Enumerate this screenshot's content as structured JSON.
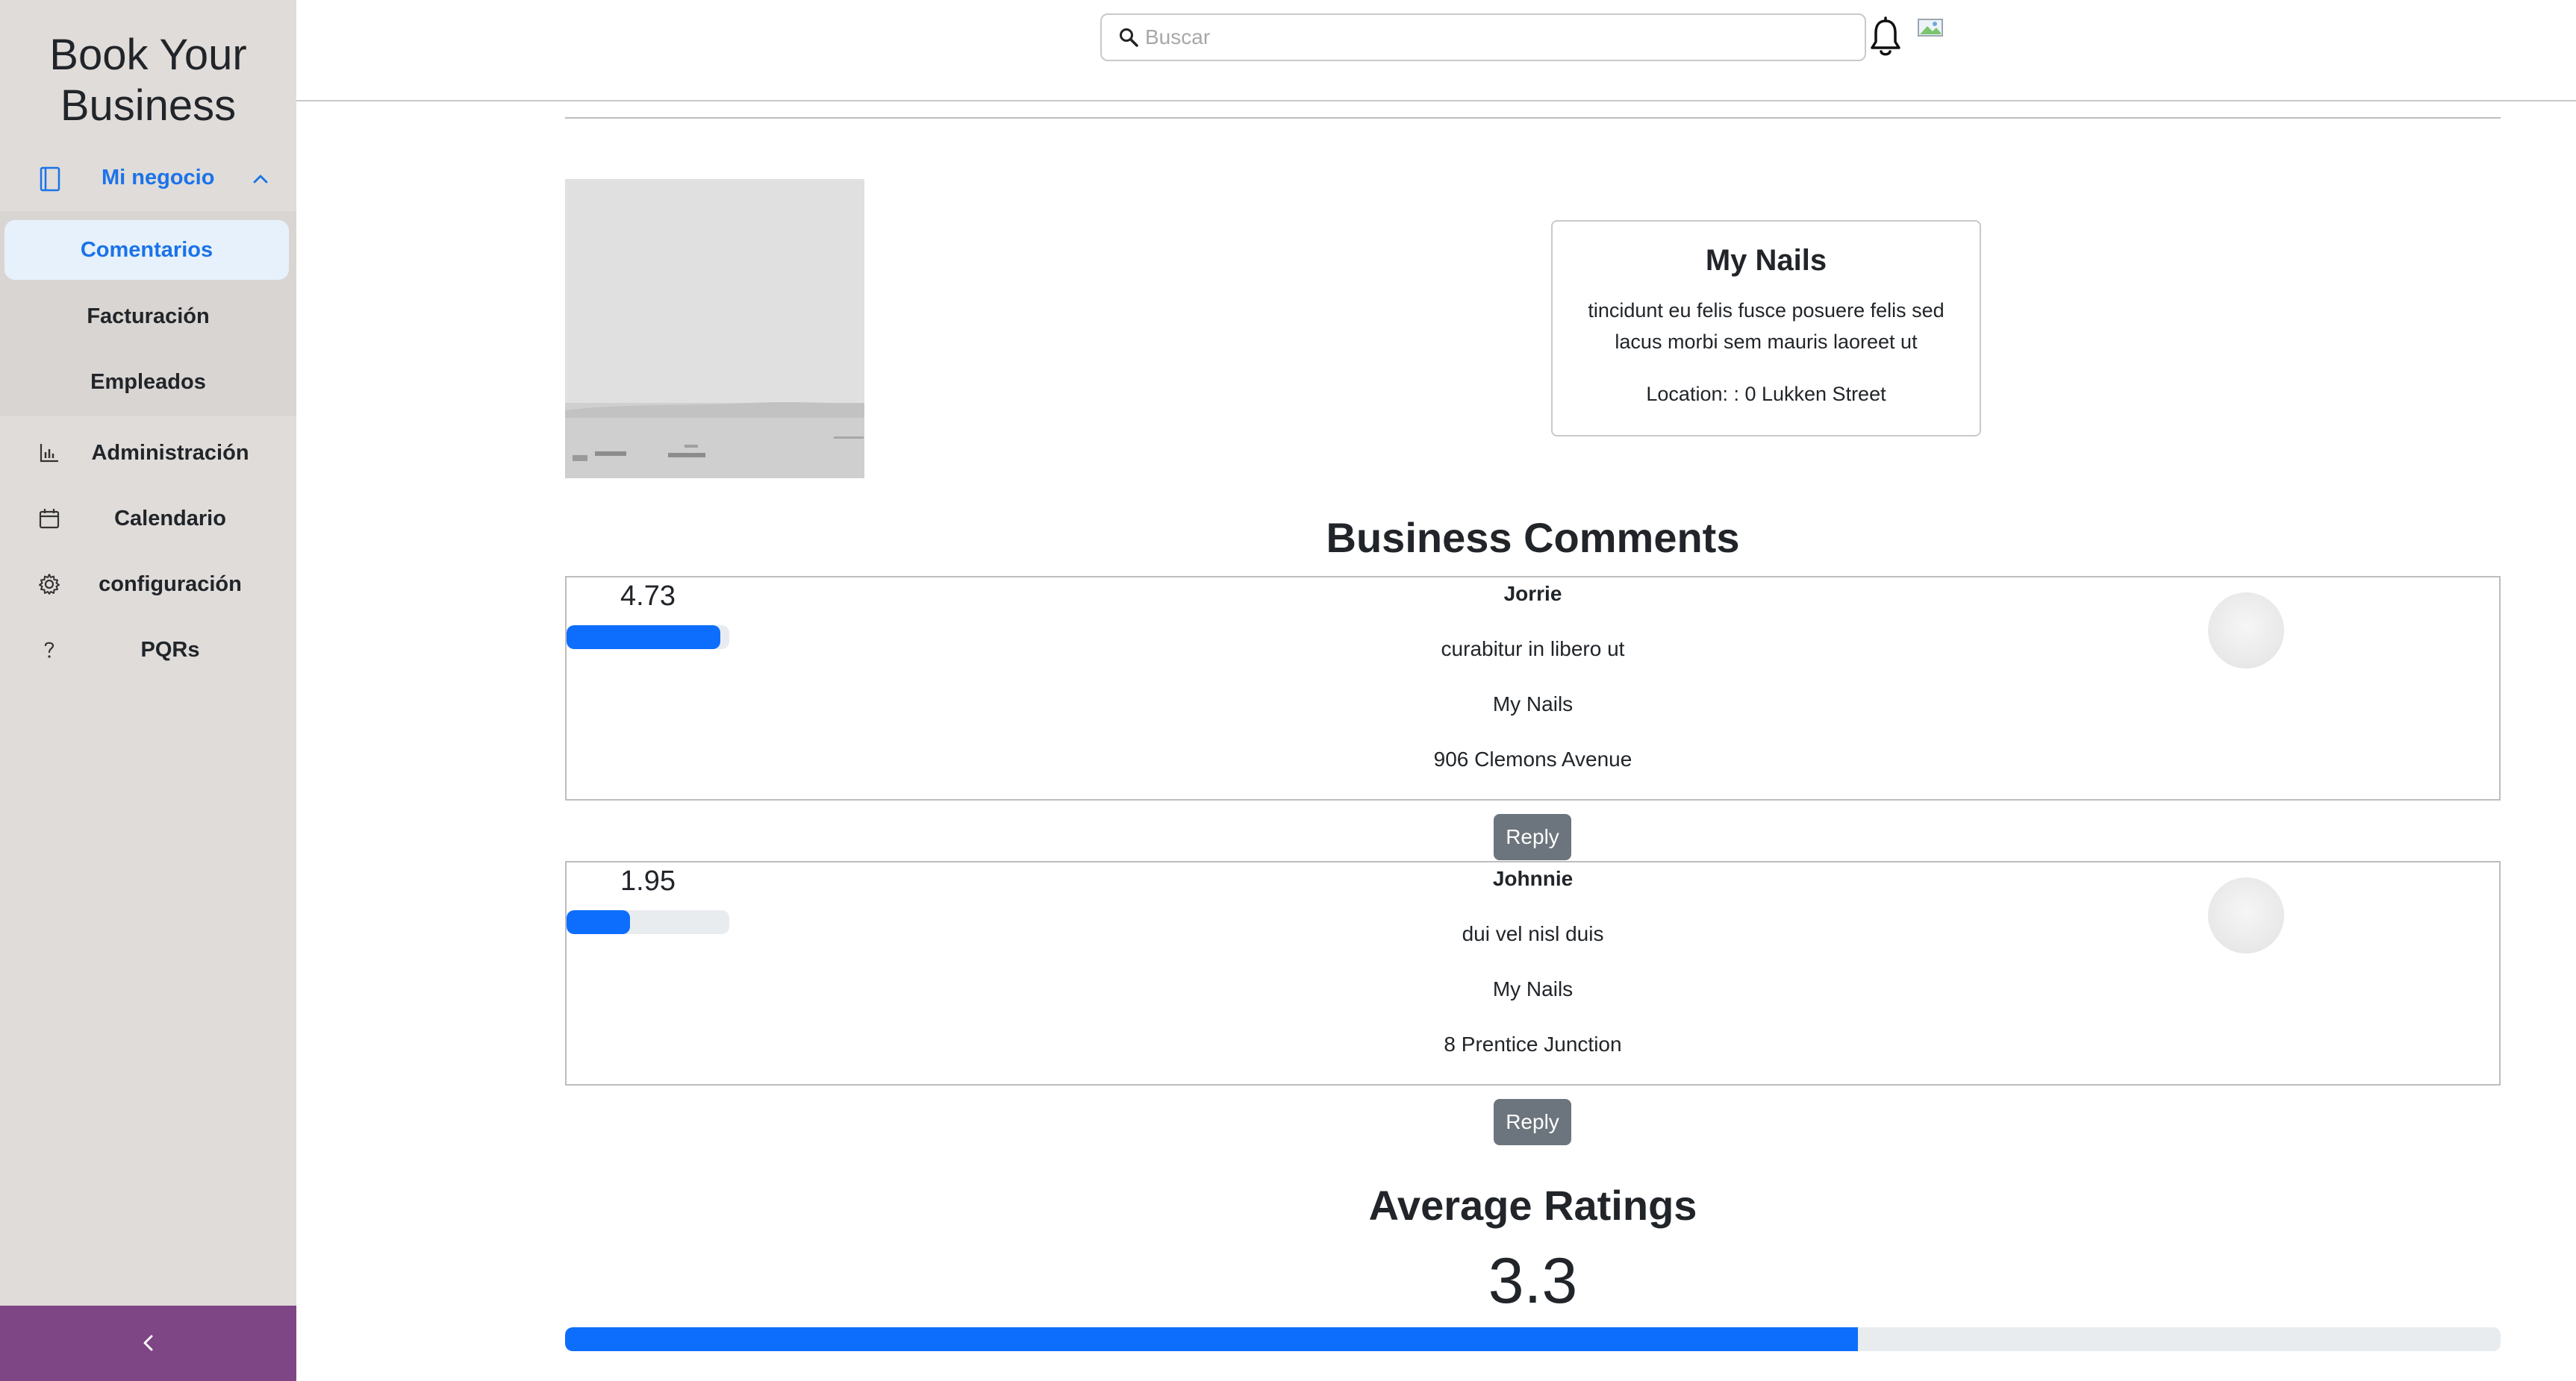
{
  "sidebar": {
    "brand": "Book Your Business",
    "parent": {
      "label": "Mi negocio",
      "icon": "book-icon",
      "expanded": true
    },
    "subitems": [
      {
        "label": "Comentarios",
        "active": true
      },
      {
        "label": "Facturación",
        "active": false
      },
      {
        "label": "Empleados",
        "active": false
      }
    ],
    "items": [
      {
        "label": "Administración",
        "icon": "bar-chart-icon"
      },
      {
        "label": "Calendario",
        "icon": "calendar-icon"
      },
      {
        "label": "configuración",
        "icon": "gear-icon"
      },
      {
        "label": "PQRs",
        "icon": "question-icon"
      }
    ],
    "collapse_icon": "chevron-left-icon",
    "collapse_color": "#7e4685"
  },
  "header": {
    "search": {
      "placeholder": "Buscar",
      "value": ""
    },
    "notification_icon": "bell-icon",
    "avatar_icon": "broken-image-icon"
  },
  "business": {
    "name": "My Nails",
    "description": "tincidunt eu felis fusce posuere felis sed lacus morbi sem mauris laoreet ut",
    "location": "Location: : 0 Lukken Street"
  },
  "comments_title": "Business Comments",
  "comments": [
    {
      "rating": "4.73",
      "rating_fraction": 0.946,
      "user": "Jorrie",
      "text": "curabitur in libero ut",
      "business": "My Nails",
      "address": "906 Clemons Avenue",
      "reply_label": "Reply"
    },
    {
      "rating": "1.95",
      "rating_fraction": 0.39,
      "user": "Johnnie",
      "text": "dui vel nisl duis",
      "business": "My Nails",
      "address": "8 Prentice Junction",
      "reply_label": "Reply"
    }
  ],
  "average": {
    "title": "Average Ratings",
    "value": "3.3",
    "fraction": 0.668
  },
  "colors": {
    "accent": "#1a73e8",
    "progress": "#0d6efd",
    "sidebar_bg": "#e0dcda",
    "reply_button": "#6c757d"
  }
}
